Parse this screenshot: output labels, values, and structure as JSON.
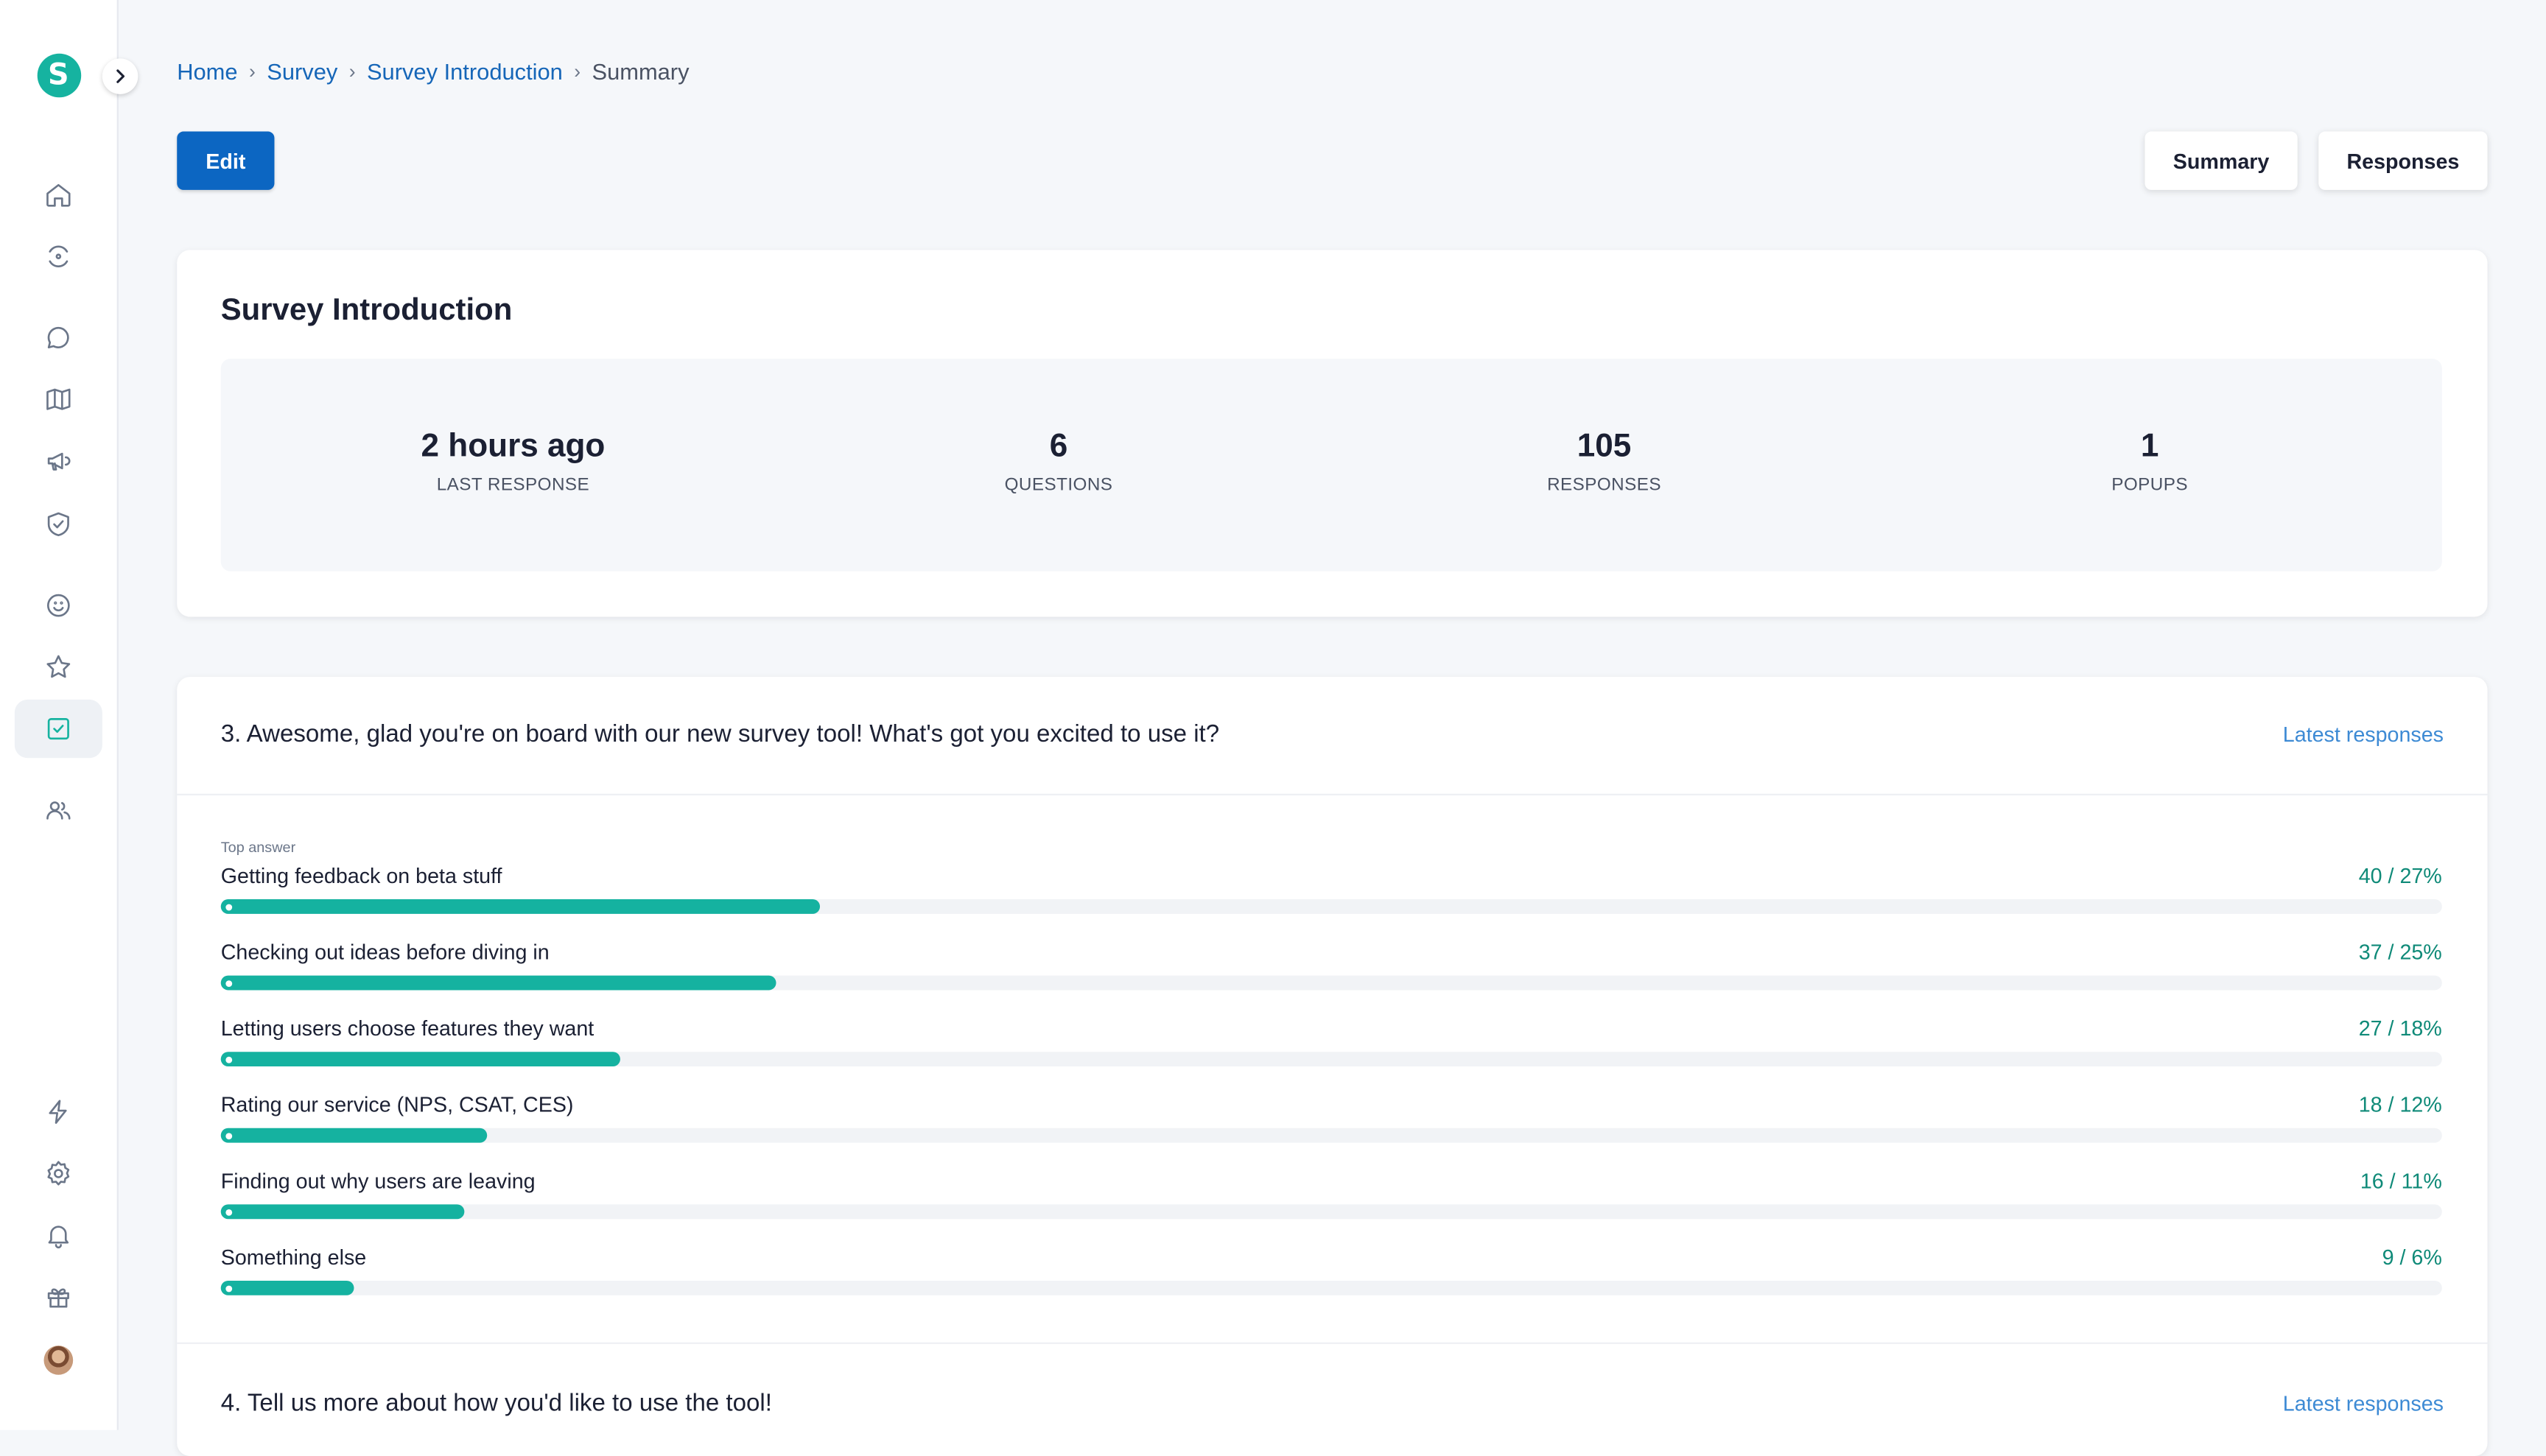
{
  "sidebar": {
    "logo_letter": "S",
    "brand_color": "#16b3a0",
    "icons": [
      "home-icon",
      "target-icon",
      "chat-icon",
      "map-icon",
      "megaphone-icon",
      "shield-check-icon",
      "smiley-icon",
      "star-icon",
      "checkbox-icon",
      "users-icon",
      "lightning-icon",
      "gear-icon",
      "bell-icon",
      "gift-icon"
    ]
  },
  "breadcrumb": {
    "items": [
      "Home",
      "Survey",
      "Survey Introduction"
    ],
    "current": "Summary"
  },
  "toolbar": {
    "edit_label": "Edit",
    "summary_label": "Summary",
    "responses_label": "Responses"
  },
  "summary": {
    "title": "Survey Introduction",
    "stats": [
      {
        "value": "2 hours ago",
        "label": "LAST RESPONSE"
      },
      {
        "value": "6",
        "label": "QUESTIONS"
      },
      {
        "value": "105",
        "label": "RESPONSES"
      },
      {
        "value": "1",
        "label": "POPUPS"
      }
    ]
  },
  "questions": [
    {
      "title": "3. Awesome, glad you're on board with our new survey tool! What's got you excited to use it?",
      "latest_link": "Latest responses",
      "top_answer_label": "Top answer",
      "answers": [
        {
          "label": "Getting feedback on beta stuff",
          "count_text": "40 / 27%",
          "fraction": 0.27
        },
        {
          "label": "Checking out ideas before diving in",
          "count_text": "37 / 25%",
          "fraction": 0.25
        },
        {
          "label": "Letting users choose features they want",
          "count_text": "27 / 18%",
          "fraction": 0.18
        },
        {
          "label": "Rating our service (NPS, CSAT, CES)",
          "count_text": "18 / 12%",
          "fraction": 0.12
        },
        {
          "label": "Finding out why users are leaving",
          "count_text": "16 / 11%",
          "fraction": 0.11
        },
        {
          "label": "Something else",
          "count_text": "9 / 6%",
          "fraction": 0.06
        }
      ]
    },
    {
      "title": "4. Tell us more about how you'd like to use the tool!",
      "latest_link": "Latest responses"
    }
  ]
}
